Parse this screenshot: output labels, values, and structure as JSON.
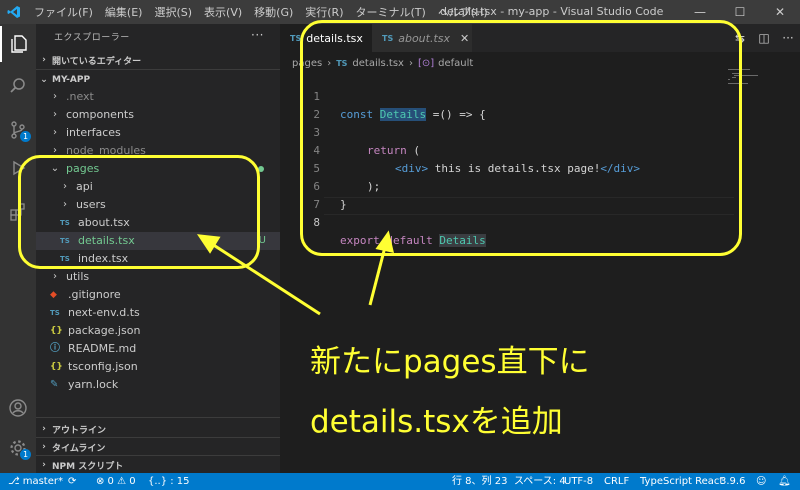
{
  "titlebar": {
    "menu": [
      "ファイル(F)",
      "編集(E)",
      "選択(S)",
      "表示(V)",
      "移動(G)",
      "実行(R)",
      "ターミナル(T)",
      "ヘルプ(H)"
    ],
    "title": "details.tsx - my-app - Visual Studio Code",
    "controls": {
      "minimize": "—",
      "maximize": "☐",
      "close": "✕"
    }
  },
  "activitybar": {
    "scm_badge": "1",
    "manage_badge": "1"
  },
  "sidebar": {
    "header": "エクスプローラー",
    "dots": "···",
    "open_editors": "開いているエディター",
    "project": "MY-APP",
    "tree": [
      {
        "label": ".next",
        "type": "folder",
        "state": "closed",
        "dim": true
      },
      {
        "label": "components",
        "type": "folder",
        "state": "closed"
      },
      {
        "label": "interfaces",
        "type": "folder",
        "state": "closed"
      },
      {
        "label": "node_modules",
        "type": "folder",
        "state": "closed",
        "dim": true
      },
      {
        "label": "pages",
        "type": "folder",
        "state": "open",
        "git": "green"
      },
      {
        "label": "api",
        "type": "folder",
        "state": "closed"
      },
      {
        "label": "users",
        "type": "folder",
        "state": "closed"
      },
      {
        "label": "about.tsx",
        "type": "ts"
      },
      {
        "label": "details.tsx",
        "type": "ts",
        "git": "U"
      },
      {
        "label": "index.tsx",
        "type": "ts"
      },
      {
        "label": "utils",
        "type": "folder",
        "state": "closed"
      },
      {
        "label": ".gitignore",
        "type": "git"
      },
      {
        "label": "next-env.d.ts",
        "type": "ts"
      },
      {
        "label": "package.json",
        "type": "json"
      },
      {
        "label": "README.md",
        "type": "info"
      },
      {
        "label": "tsconfig.json",
        "type": "json"
      },
      {
        "label": "yarn.lock",
        "type": "yarn"
      }
    ],
    "ts_mark": "TS",
    "json_mark": "{}",
    "git_u": "U",
    "outline": "アウトライン",
    "timeline": "タイムライン",
    "npm": "NPM スクリプト"
  },
  "editor": {
    "tabs": [
      {
        "label": "details.tsx",
        "active": true
      },
      {
        "label": "about.tsx",
        "active": false
      }
    ],
    "ts_mark": "TS",
    "tab_close": "✕",
    "breadcrumb": [
      "pages",
      "details.tsx",
      "default"
    ],
    "breadcrumb_sep": "›",
    "line_numbers": [
      "1",
      "2",
      "3",
      "4",
      "5",
      "6",
      "7",
      "8"
    ],
    "code": {
      "l1_kw": "const",
      "l1_name": "Details",
      "l1_rest": " =() => {",
      "l4_open": "<div>",
      "l4_text": " this is details.tsx page!",
      "l4_close": "</div>",
      "l3_kw": "return",
      "l3_rest": " (",
      "l5": ");",
      "l6": "}",
      "l8_kw": "export default",
      "l8_name": "Details"
    }
  },
  "annotation": {
    "line1": "新たにpages直下に",
    "line2": "details.tsxを追加"
  },
  "statusbar": {
    "branch": "master*",
    "errors": "⊗ 0 ⚠ 0",
    "lang_status": "{..} : 15",
    "position": "行 8、列 23",
    "spaces": "スペース: 4",
    "encoding": "UTF-8",
    "eol": "CRLF",
    "language": "TypeScript React",
    "version": "3.9.6"
  }
}
